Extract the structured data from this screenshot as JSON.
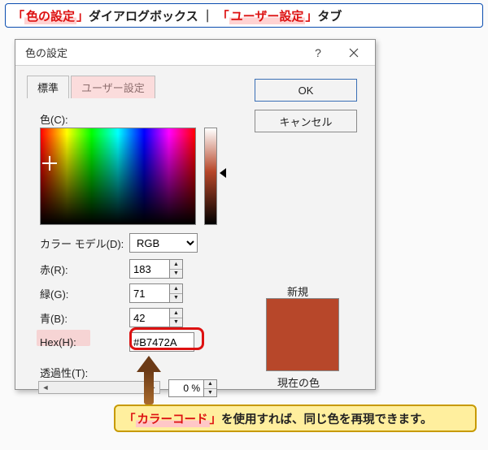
{
  "caption_top": {
    "open": "「",
    "keyword": "色の設定",
    "close": "」",
    "middle1": "ダイアログボックス",
    "pipe": "｜",
    "open2": "「",
    "keyword2": "ユーザー設定",
    "close2": "」",
    "tail": "タブ"
  },
  "dialog": {
    "title": "色の設定",
    "help": "?",
    "tabs": {
      "std": "標準",
      "custom": "ユーザー設定"
    },
    "buttons": {
      "ok": "OK",
      "cancel": "キャンセル"
    },
    "labels": {
      "color": "色(C):",
      "model": "カラー モデル(D):",
      "r": "赤(R):",
      "g": "緑(G):",
      "b": "青(B):",
      "hex": "Hex(H):",
      "trans": "透過性(T):",
      "new": "新規",
      "current": "現在の色"
    },
    "values": {
      "model": "RGB",
      "r": "183",
      "g": "71",
      "b": "42",
      "hex": "#B7472A",
      "trans": "0 %",
      "swatch": "#B7472A"
    }
  },
  "caption_bottom": {
    "open": "「",
    "keyword": "カラーコード",
    "close": "」",
    "tail": "を使用すれば、同じ色を再現できます。"
  }
}
